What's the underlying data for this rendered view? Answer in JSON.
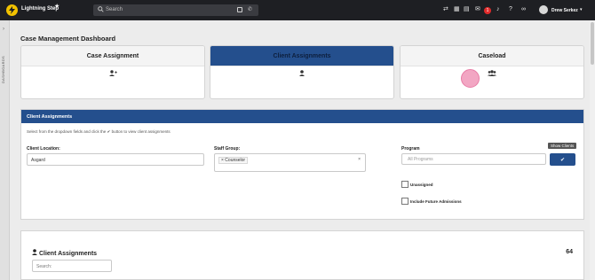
{
  "topbar": {
    "app_title": "Lightning Step",
    "search_placeholder": "Search",
    "notification_count": "1",
    "user_name": "Drew Serkez"
  },
  "sidebar": {
    "vertical_label": "DASHBOARDS"
  },
  "page": {
    "title": "Case Management Dashboard"
  },
  "cards": [
    {
      "label": "Case Assignment",
      "icon": "user-plus-icon"
    },
    {
      "label": "Client Assignments",
      "icon": "user-icon",
      "active": true
    },
    {
      "label": "Caseload",
      "icon": "users-icon"
    }
  ],
  "panel": {
    "header": "Client Assignments",
    "instructions": "Select from the dropdown fields and click the ✔ button to view client assignments",
    "client_location": {
      "label": "Client Location:",
      "value": "Asgard"
    },
    "staff_group": {
      "label": "Staff Group:",
      "tag": "× Counselor"
    },
    "program": {
      "label": "Program",
      "placeholder": "All Programs"
    },
    "unassigned_label": "Unassigned",
    "future_admissions_label": "Include Future Admissions",
    "show_clients_tooltip": "Show Clients"
  },
  "list": {
    "title": "Client Assignments",
    "count": "64",
    "search_placeholder": "Search:"
  },
  "colors": {
    "primary": "#244f8d",
    "topbar": "#1e1f23",
    "badge": "#e12b2b"
  }
}
